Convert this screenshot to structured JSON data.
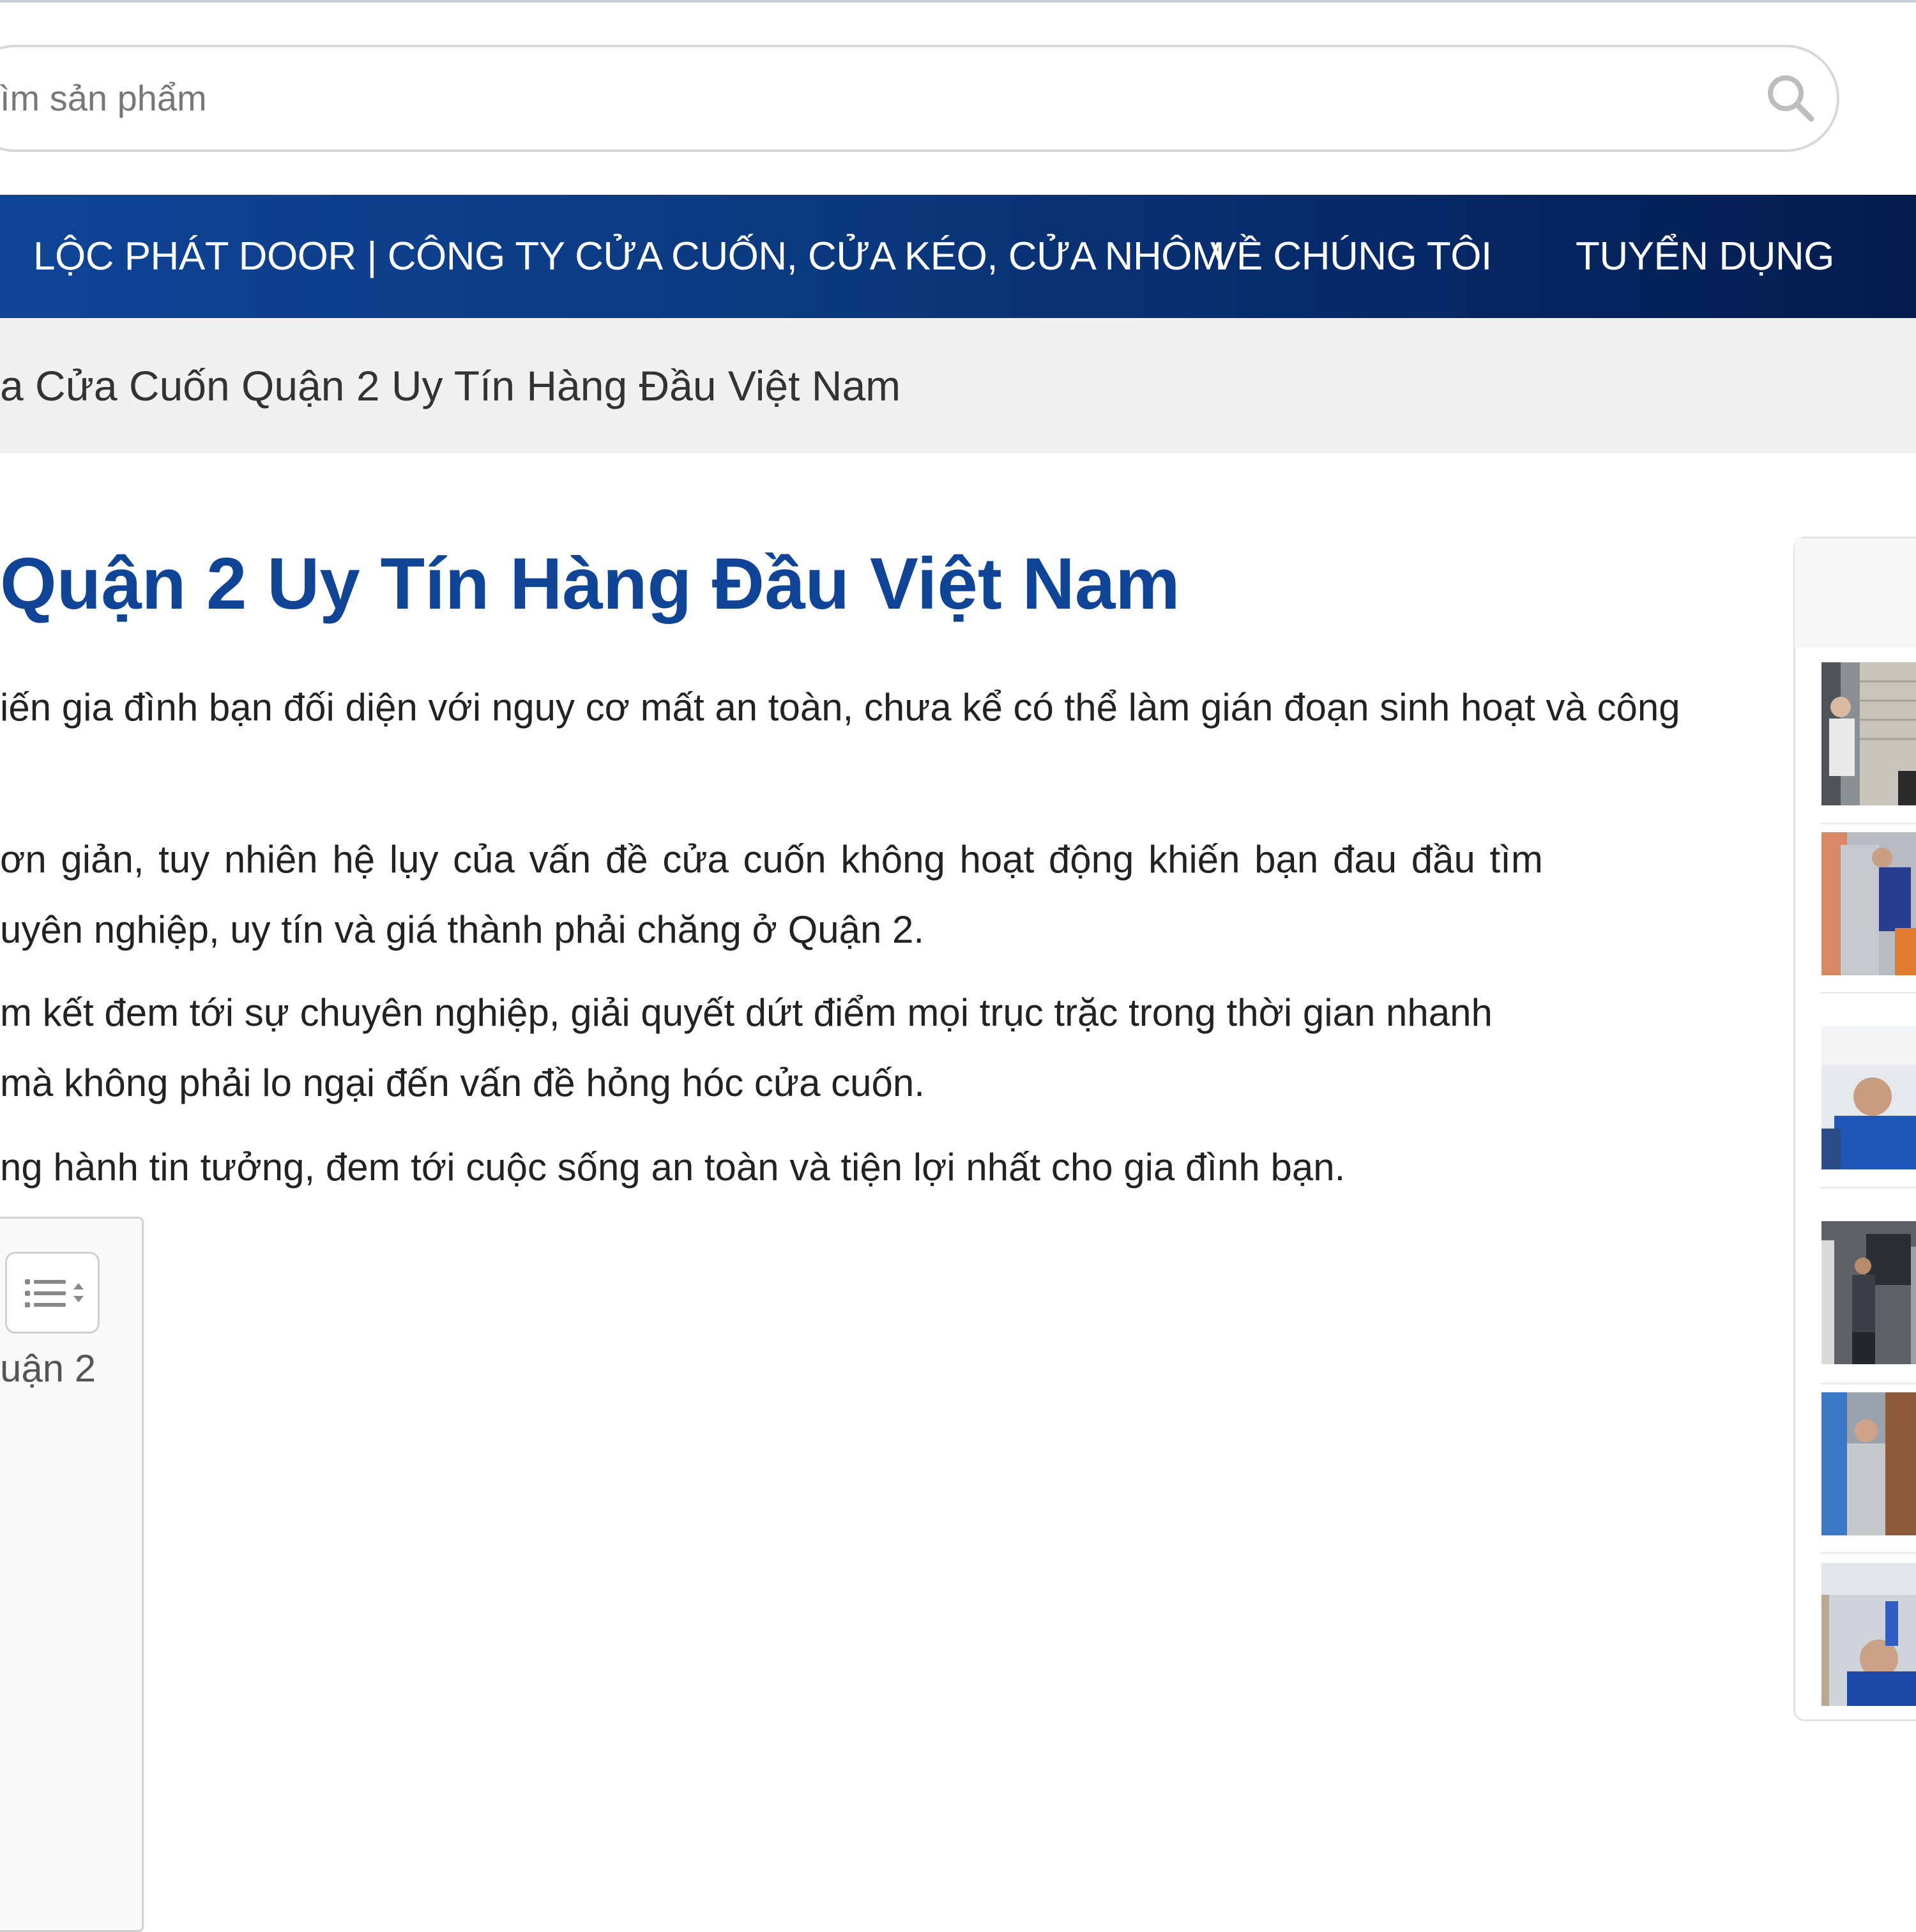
{
  "search": {
    "placeholder_visible": "ìm sản phẩm",
    "icon": "search-icon"
  },
  "nav": {
    "items": [
      {
        "label": "LỘC PHÁT DOOR | CÔNG TY CỬA CUỐN, CỬA KÉO, CỬA NHÔM"
      },
      {
        "label": "VỀ CHÚNG TÔI"
      },
      {
        "label": "TUYỂN DỤNG"
      }
    ],
    "colors": {
      "start": "#0f4496",
      "end": "#041c4d"
    }
  },
  "breadcrumb": {
    "current": "a Cửa Cuốn Quận 2 Uy Tín Hàng Đầu Việt Nam"
  },
  "article": {
    "title": "Quận 2 Uy Tín Hàng Đầu Việt Nam",
    "title_color": "#0f4496",
    "paragraphs": [
      {
        "lines": [
          "iến gia đình bạn đối diện với nguy cơ mất an toàn, chưa kể có thể làm gián đoạn sinh hoạt và công"
        ]
      },
      {
        "lines": [
          "ơn giản, tuy nhiên hệ lụy của vấn đề cửa cuốn không hoạt động khiến bạn đau đầu tìm",
          "uyên nghiệp, uy tín và giá thành phải chăng ở Quận 2."
        ]
      },
      {
        "lines": [
          "m kết đem tới sự chuyên nghiệp, giải quyết dứt điểm mọi trục trặc trong thời gian nhanh",
          "mà không phải lo ngại đến vấn đề hỏng hóc cửa cuốn."
        ]
      },
      {
        "lines": [
          "ng hành tin tưởng, đem tới cuộc sống an toàn và tiện lợi nhất cho gia đình bạn."
        ]
      }
    ]
  },
  "toc": {
    "toggle_icon": "list-toggle-icon",
    "items": [
      {
        "label": "uận 2"
      }
    ]
  },
  "sidebar": {
    "thumbnails": [
      {
        "icon": "worker-photo-thumbnail"
      },
      {
        "icon": "worker-photo-thumbnail"
      },
      {
        "icon": "worker-photo-thumbnail"
      },
      {
        "icon": "worker-photo-thumbnail"
      },
      {
        "icon": "worker-photo-thumbnail"
      },
      {
        "icon": "worker-photo-thumbnail"
      }
    ]
  }
}
